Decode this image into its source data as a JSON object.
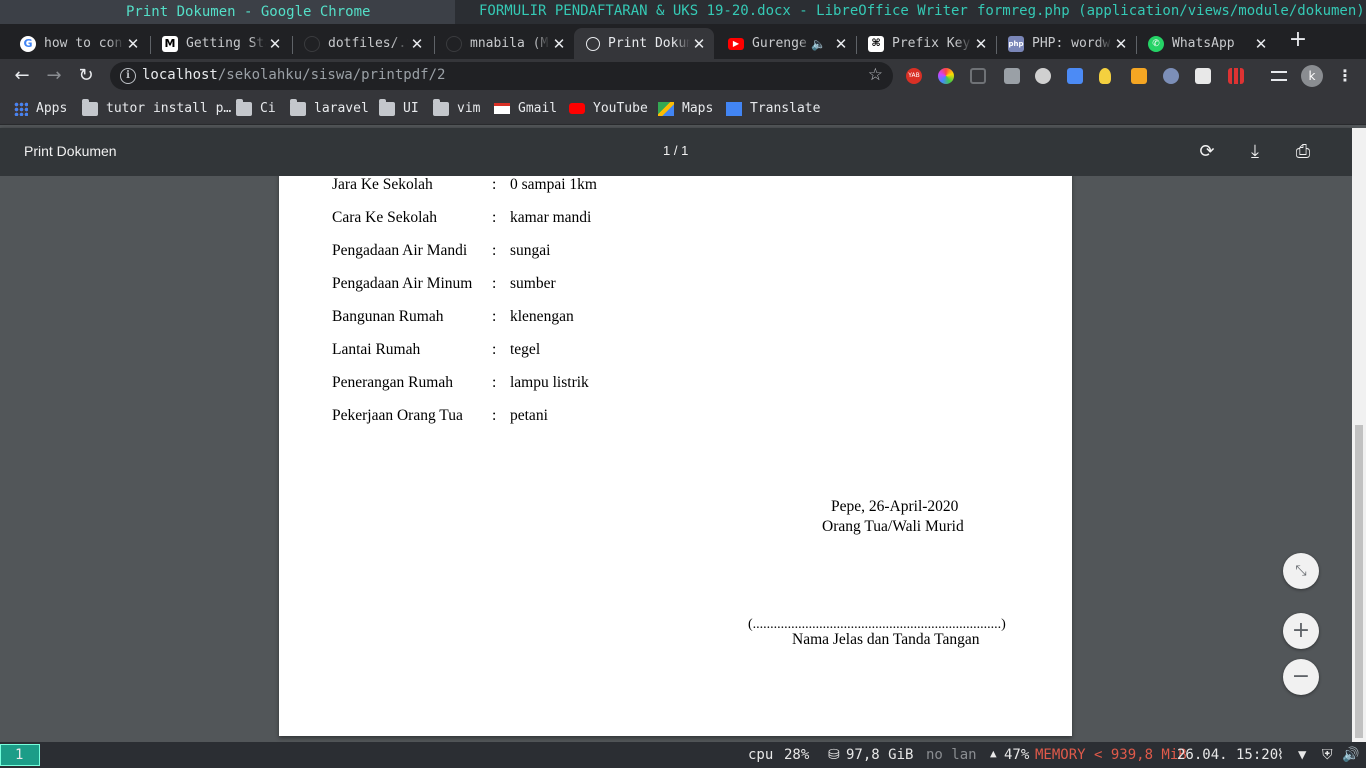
{
  "wm": {
    "titles": [
      "Print Dokumen - Google Chrome",
      "FORMULIR PENDAFTARAN & UKS 19-20.docx - LibreOffice Writer",
      "formreg.php (application/views/module/dokumen)"
    ]
  },
  "tabs": [
    {
      "title": "how to conn",
      "icon": "google-icon"
    },
    {
      "title": "Getting Sta",
      "icon": "medium-icon"
    },
    {
      "title": "dotfiles/.t",
      "icon": "github-icon"
    },
    {
      "title": "mnabila (M.",
      "icon": "github-icon"
    },
    {
      "title": "Print Dokum",
      "icon": "globe-icon"
    },
    {
      "title": "Gurenge",
      "icon": "youtube-icon"
    },
    {
      "title": "Prefix Keys",
      "icon": "mouse-icon"
    },
    {
      "title": "PHP: wordwr",
      "icon": "php-icon"
    },
    {
      "title": "WhatsApp",
      "icon": "whatsapp-icon"
    }
  ],
  "omnibox": {
    "host": "localhost",
    "path": "/sekolahku/siswa/printpdf/2"
  },
  "bookmarks": [
    {
      "label": "Apps",
      "icon": "apps-icon"
    },
    {
      "label": "tutor install p…",
      "icon": "folder-icon"
    },
    {
      "label": "Ci",
      "icon": "folder-icon"
    },
    {
      "label": "laravel",
      "icon": "folder-icon"
    },
    {
      "label": "UI",
      "icon": "folder-icon"
    },
    {
      "label": "vim",
      "icon": "folder-icon"
    },
    {
      "label": "Gmail",
      "icon": "gmail-icon"
    },
    {
      "label": "YouTube",
      "icon": "youtube-icon"
    },
    {
      "label": "Maps",
      "icon": "maps-icon"
    },
    {
      "label": "Translate",
      "icon": "translate-icon"
    }
  ],
  "avatar": "k",
  "pdf": {
    "title": "Print Dokumen",
    "pages": "1 / 1",
    "rows": [
      {
        "label": "Jara Ke Sekolah",
        "value": "0 sampai 1km"
      },
      {
        "label": "Cara Ke Sekolah",
        "value": "kamar mandi"
      },
      {
        "label": "Pengadaan Air Mandi",
        "value": "sungai"
      },
      {
        "label": "Pengadaan Air Minum",
        "value": "sumber"
      },
      {
        "label": "Bangunan Rumah",
        "value": "klenengan"
      },
      {
        "label": "Lantai Rumah",
        "value": "tegel"
      },
      {
        "label": "Penerangan Rumah",
        "value": "lampu listrik"
      },
      {
        "label": "Pekerjaan Orang Tua",
        "value": "petani"
      }
    ],
    "colon": ":",
    "place_date": "Pepe, 26-April-2020",
    "signer_role": "Orang Tua/Wali Murid",
    "dotted_line": "(.......................................................................)",
    "signature_caption": "Nama Jelas dan Tanda Tangan"
  },
  "statusbar": {
    "workspace": "1",
    "cpu_label": "cpu",
    "cpu": "28%",
    "disk": "97,8 GiB",
    "lan": "no lan",
    "battery": "47%",
    "memory": "MEMORY < 939,8 MiB",
    "datetime": "26.04. 15:20"
  },
  "colors": {
    "accent": "#35c9b5",
    "memory_alert": "#e05a4a",
    "workspace": "#1c9d88"
  }
}
